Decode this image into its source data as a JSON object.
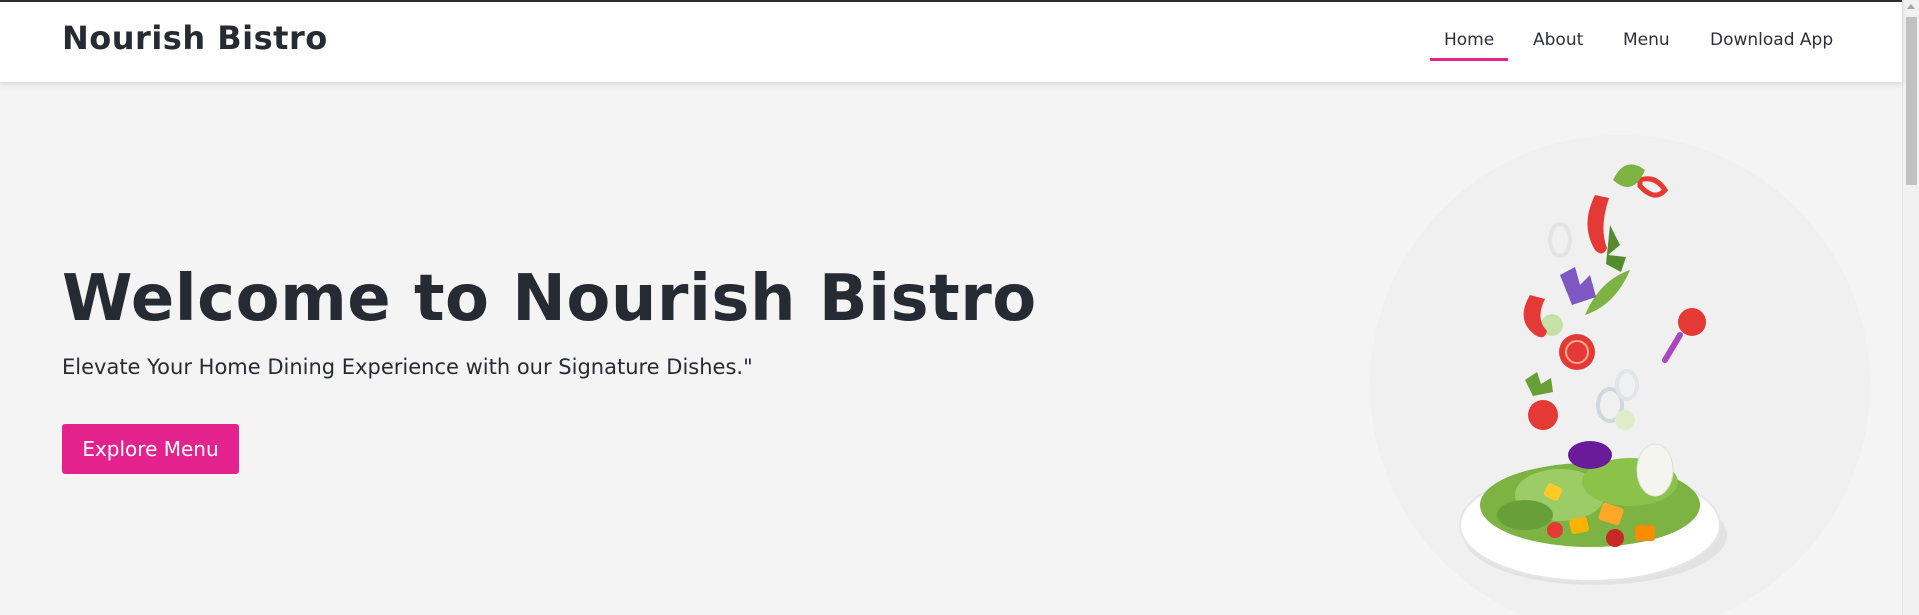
{
  "brand": {
    "name": "Nourish Bistro"
  },
  "nav": {
    "items": [
      {
        "label": "Home",
        "active": true
      },
      {
        "label": "About",
        "active": false
      },
      {
        "label": "Menu",
        "active": false
      },
      {
        "label": "Download App",
        "active": false
      }
    ]
  },
  "hero": {
    "title": "Welcome to Nourish Bistro",
    "subtitle": "Elevate Your Home Dining Experience with our Signature Dishes.\"",
    "cta_label": "Explore Menu",
    "image_icon": "salad-bowl-image"
  },
  "colors": {
    "accent": "#e3228d",
    "text": "#262b33",
    "background": "#f4f4f4",
    "navbar": "#ffffff"
  }
}
